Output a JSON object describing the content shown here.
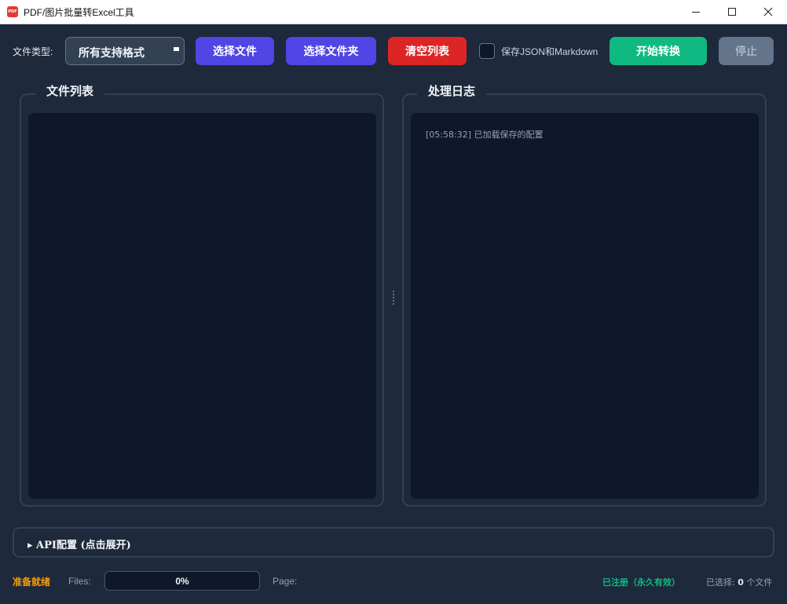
{
  "window": {
    "icon_text": "PDF",
    "title": "PDF/图片批量转Excel工具"
  },
  "toolbar": {
    "file_type_label": "文件类型:",
    "file_type_value": "所有支持格式",
    "select_file_label": "选择文件",
    "select_folder_label": "选择文件夹",
    "clear_list_label": "清空列表",
    "save_json_md_label": "保存JSON和Markdown",
    "save_json_md_checked": false,
    "start_label": "开始转换",
    "stop_label": "停止"
  },
  "file_panel": {
    "title": "文件列表",
    "items": []
  },
  "log_panel": {
    "title": "处理日志",
    "lines": [
      "[05:58:32] 已加载保存的配置"
    ]
  },
  "api_config": {
    "label": "▸ API配置 (点击展开)"
  },
  "status": {
    "ready_text": "准备就绪",
    "files_label": "Files:",
    "progress_text": "0%",
    "progress_value": 0,
    "page_label": "Page:",
    "registered_text": "已注册（永久有效）",
    "selected_prefix": "已选择:",
    "selected_count": "0",
    "selected_suffix": "个文件"
  },
  "colors": {
    "background": "#1e293b",
    "primary_button": "#4f46e5",
    "danger_button": "#dc2626",
    "success_button": "#10b981",
    "disabled_button": "#64748b",
    "ready_status": "#f59e0b"
  }
}
